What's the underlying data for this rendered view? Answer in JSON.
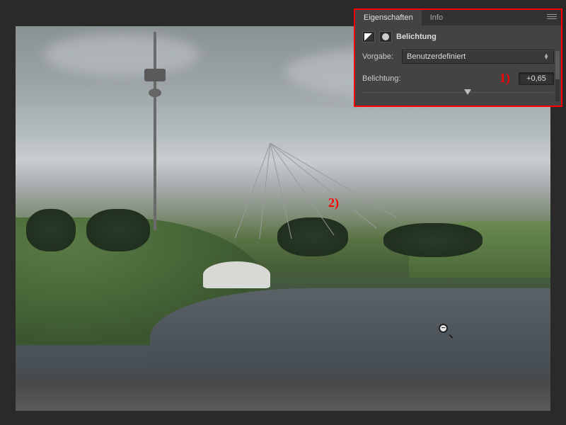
{
  "panel": {
    "tabs": {
      "properties": "Eigenschaften",
      "info": "Info"
    },
    "adjustment_title": "Belichtung",
    "preset_label": "Vorgabe:",
    "preset_value": "Benutzerdefiniert",
    "exposure_label": "Belichtung:",
    "exposure_value": "+0,65",
    "slider_position_pct": 55
  },
  "annotations": {
    "one": "1)",
    "two": "2)"
  },
  "cursor": {
    "glyph": "−"
  }
}
